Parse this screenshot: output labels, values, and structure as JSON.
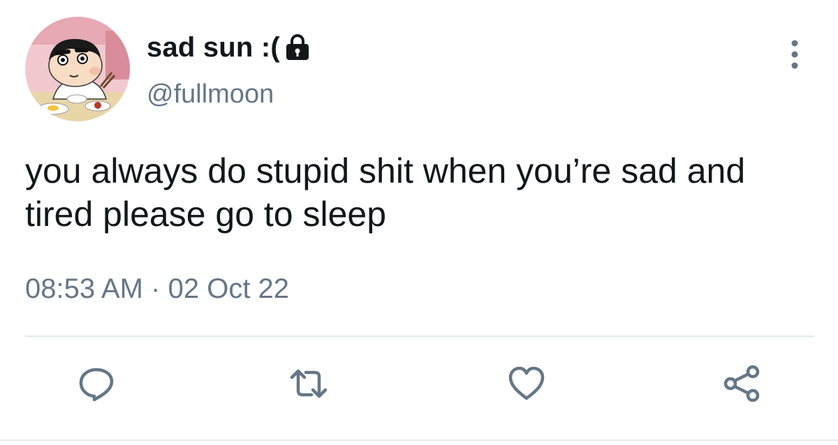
{
  "tweet": {
    "display_name": "sad sun :(",
    "handle": "@fullmoon",
    "text": "you always do stupid shit when you’re sad and tired please go to sleep",
    "time": "08:53 AM",
    "separator": "·",
    "date": "02 Oct 22"
  },
  "icons": {
    "lock": "lock-icon",
    "more": "more-vertical-icon",
    "reply": "reply-icon",
    "retweet": "retweet-icon",
    "like": "heart-icon",
    "share": "share-icon"
  },
  "colors": {
    "text": "#14171a",
    "secondary": "#657786",
    "icon": "#657786",
    "divider": "#e1e8ed"
  }
}
